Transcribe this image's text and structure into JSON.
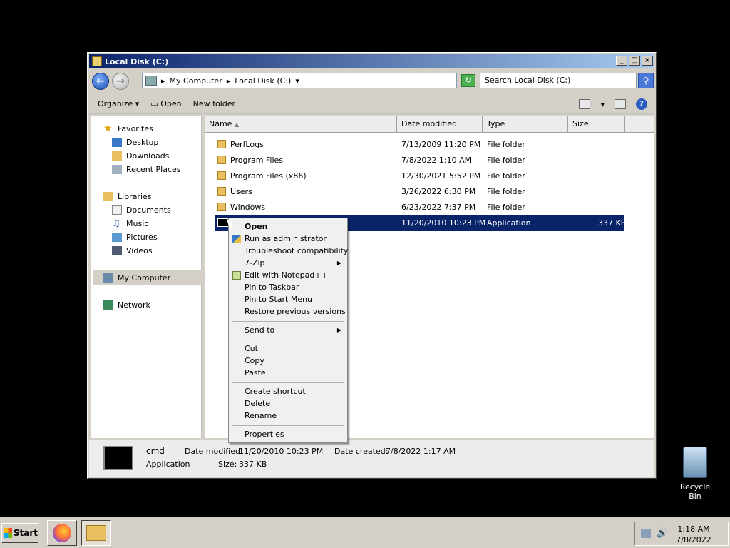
{
  "window": {
    "title": "Local Disk (C:)",
    "min": "_",
    "max": "□",
    "close": "×"
  },
  "address": {
    "crumb1": "My Computer",
    "crumb2": "Local Disk (C:)",
    "sep": "▸"
  },
  "search": {
    "placeholder": "Search Local Disk (C:)"
  },
  "toolbar": {
    "organize": "Organize ▾",
    "open": "Open",
    "new_folder": "New folder"
  },
  "nav": {
    "favorites": "Favorites",
    "desktop": "Desktop",
    "downloads": "Downloads",
    "recent": "Recent Places",
    "libraries": "Libraries",
    "documents": "Documents",
    "music": "Music",
    "pictures": "Pictures",
    "videos": "Videos",
    "computer": "My Computer",
    "network": "Network"
  },
  "columns": {
    "name": "Name",
    "date": "Date modified",
    "type": "Type",
    "size": "Size"
  },
  "files": [
    {
      "name": "PerfLogs",
      "date": "7/13/2009 11:20 PM",
      "type": "File folder",
      "size": ""
    },
    {
      "name": "Program Files",
      "date": "7/8/2022 1:10 AM",
      "type": "File folder",
      "size": ""
    },
    {
      "name": "Program Files (x86)",
      "date": "12/30/2021 5:52 PM",
      "type": "File folder",
      "size": ""
    },
    {
      "name": "Users",
      "date": "3/26/2022 6:30 PM",
      "type": "File folder",
      "size": ""
    },
    {
      "name": "Windows",
      "date": "6/23/2022 7:37 PM",
      "type": "File folder",
      "size": ""
    },
    {
      "name": "cmd",
      "date": "11/20/2010 10:23 PM",
      "type": "Application",
      "size": "337 KB"
    }
  ],
  "context_menu": {
    "open": "Open",
    "run_admin": "Run as administrator",
    "troubleshoot": "Troubleshoot compatibility",
    "zip": "7-Zip",
    "notepad": "Edit with Notepad++",
    "pin_taskbar": "Pin to Taskbar",
    "pin_start": "Pin to Start Menu",
    "restore": "Restore previous versions",
    "send_to": "Send to",
    "cut": "Cut",
    "copy": "Copy",
    "paste": "Paste",
    "shortcut": "Create shortcut",
    "delete": "Delete",
    "rename": "Rename",
    "properties": "Properties"
  },
  "details": {
    "name": "cmd",
    "type": "Application",
    "modified_label": "Date modified:",
    "modified": "11/20/2010 10:23 PM",
    "created_label": "Date created:",
    "created": "7/8/2022 1:17 AM",
    "size_label": "Size:",
    "size": "337 KB"
  },
  "desktop": {
    "recycle_bin": "Recycle Bin"
  },
  "taskbar": {
    "start": "Start",
    "time": "1:18 AM",
    "date": "7/8/2022"
  }
}
